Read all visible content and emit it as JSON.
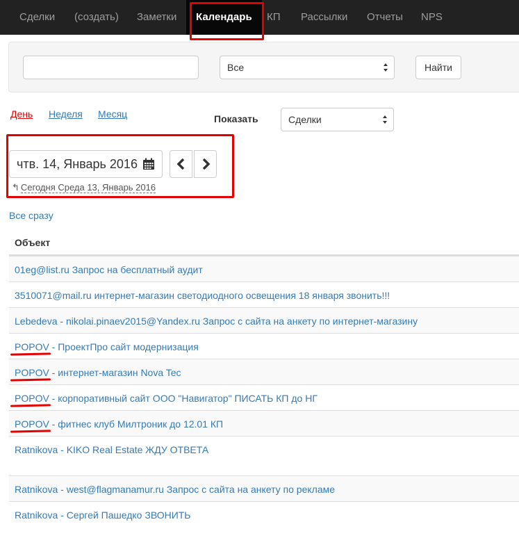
{
  "nav": {
    "items": [
      "Сделки",
      "(создать)",
      "Заметки",
      "Календарь",
      "КП",
      "Рассылки",
      "Отчеты",
      "NPS"
    ],
    "active": "Календарь"
  },
  "filter": {
    "search_value": "",
    "status_select": "Все",
    "find_button": "Найти"
  },
  "views": {
    "day": "День",
    "week": "Неделя",
    "month": "Месяц",
    "active": "День"
  },
  "show": {
    "label": "Показать",
    "select": "Сделки"
  },
  "date": {
    "current": "чтв. 14, Январь 2016",
    "today_icon": "↰",
    "today": "Сегодня Среда 13, Январь 2016"
  },
  "all_link": "Все сразу",
  "table": {
    "header": "Объект",
    "rows": [
      "01eg@list.ru Запрос на бесплатный аудит",
      "3510071@mail.ru интернет-магазин светодиодного освещения 18 января звонить!!!",
      "Lebedeva - nikolai.pinaev2015@Yandex.ru Запрос с сайта на анкету по интернет-магазину",
      "POPOV - ПроектПро сайт модернизация",
      "POPOV - интернет-магазин Nova Tec",
      "POPOV - корпоративный сайт ООО \"Навигатор\" ПИСАТЬ КП до НГ",
      "POPOV - фитнес клуб Милтроник до 12.01 КП",
      "Ratnikova - KIKO Real Estate ЖДУ ОТВЕТА",
      "Ratnikova - west@flagmanamur.ru Запрос с сайта на анкету по рекламе",
      "Ratnikova - Сергей Пашедко ЗВОНИТЬ"
    ]
  },
  "colors": {
    "navbar": "#222222",
    "link": "#337ab7",
    "annotation_red": "#e50000"
  }
}
